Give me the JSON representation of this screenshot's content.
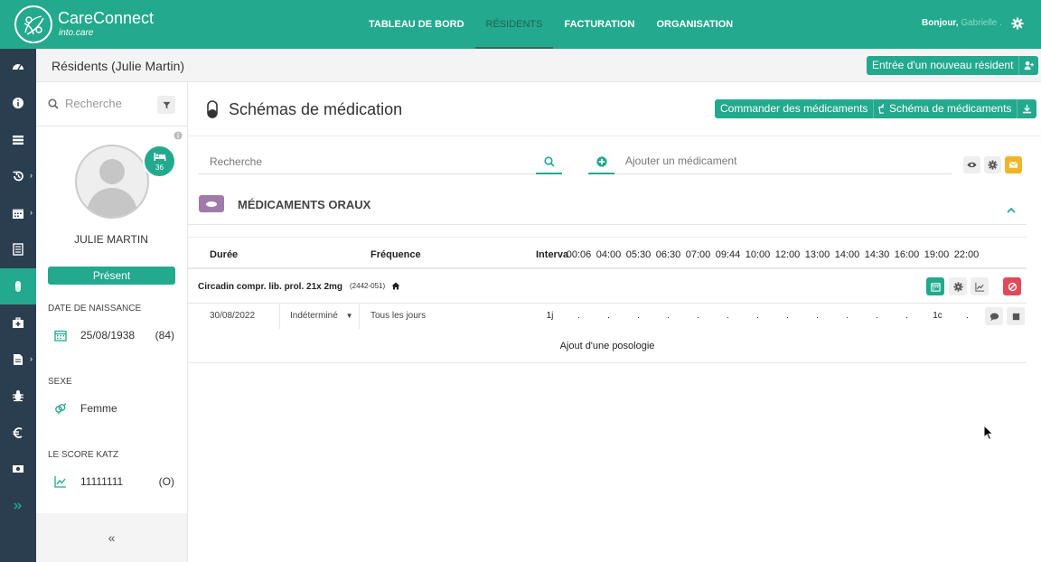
{
  "app": {
    "name": "CareConnect",
    "subtitle": "into.care"
  },
  "nav": {
    "items": [
      {
        "label": "TABLEAU DE BORD"
      },
      {
        "label": "RÉSIDENTS"
      },
      {
        "label": "FACTURATION"
      },
      {
        "label": "ORGANISATION"
      }
    ],
    "active_index": 1
  },
  "user": {
    "greeting": "Bonjour,",
    "name": "Gabrielle ."
  },
  "subheader": {
    "title": "Résidents (Julie Martin)",
    "new_resident_button": "Entrée d'un nouveau résident"
  },
  "patient": {
    "search_placeholder": "Recherche",
    "bed_number": "36",
    "name": "JULIE MARTIN",
    "status": "Présent",
    "dob_label": "DATE DE NAISSANCE",
    "dob": "25/08/1938",
    "age": "(84)",
    "sex_label": "SEXE",
    "sex": "Femme",
    "katz_label": "LE SCORE KATZ",
    "katz": "11111111",
    "katz_class": "(O)",
    "collapse_label": "«"
  },
  "main": {
    "title": "Schémas de médication",
    "order_button": "Commander des médicaments",
    "scheme_button": "Schéma de médicaments",
    "search_placeholder": "Recherche",
    "add_placeholder": "Ajouter un médicament",
    "section_title": "MÉDICAMENTS ORAUX",
    "columns": {
      "duration": "Durée",
      "frequency": "Fréquence",
      "interval": "Interva",
      "times": [
        "00:06",
        "04:00",
        "05:30",
        "06:30",
        "07:00",
        "09:44",
        "10:00",
        "12:00",
        "13:00",
        "14:00",
        "14:30",
        "16:00",
        "19:00",
        "22:00"
      ]
    },
    "medication": {
      "name": "Circadin compr. lib. prol. 21x 2mg",
      "code": "(2442-051)",
      "dose": {
        "start": "30/08/2022",
        "end": "Indéterminé",
        "frequency": "Tous les jours",
        "interval": "1j",
        "values": [
          ".",
          ".",
          ".",
          ".",
          ".",
          ".",
          ".",
          ".",
          ".",
          ".",
          ".",
          ".",
          "1c",
          "."
        ]
      }
    },
    "add_posology": "Ajout d'une posologie"
  },
  "colors": {
    "primary": "#23a98d",
    "rail": "#2b3e50",
    "section_pill": "#a07aa8",
    "danger": "#e04a5a",
    "warning": "#f0b429"
  }
}
